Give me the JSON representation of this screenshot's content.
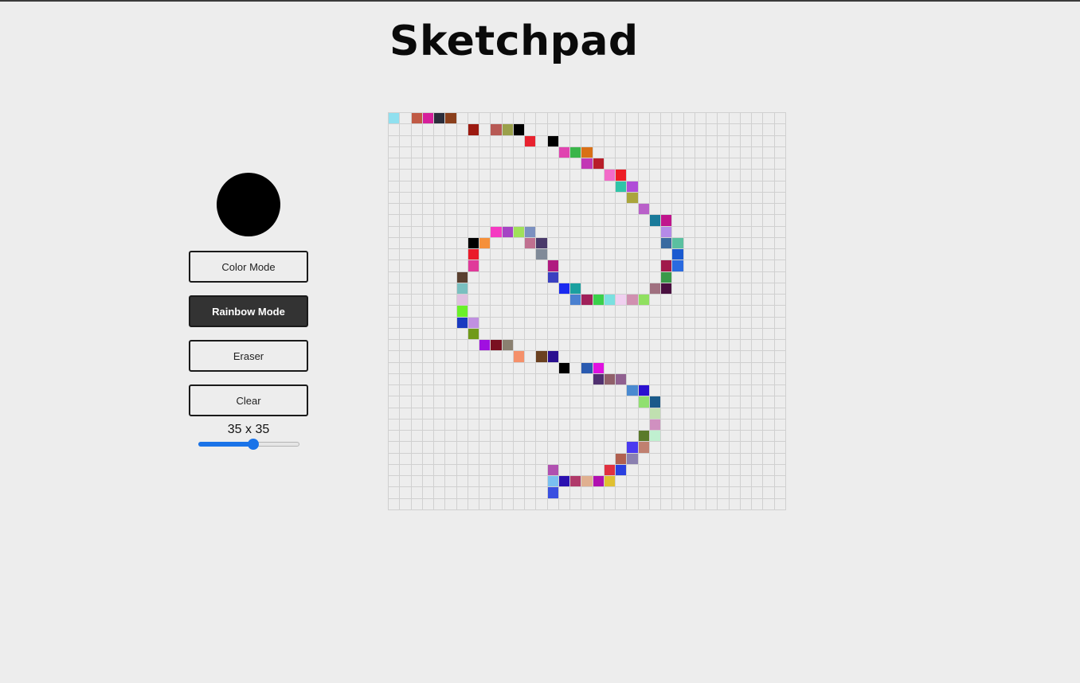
{
  "app": {
    "title": "Sketchpad"
  },
  "current_color": "#000000",
  "buttons": {
    "color_mode": "Color Mode",
    "rainbow_mode": "Rainbow Mode",
    "eraser": "Eraser",
    "clear": "Clear"
  },
  "active_mode": "rainbow_mode",
  "grid": {
    "size": 35,
    "size_label": "35 x 35",
    "slider": {
      "min": 1,
      "max": 64,
      "value": 35
    },
    "background": "#ededed",
    "line_color": "#d0d0d0",
    "painted": [
      [
        0,
        0,
        "#90e0ef"
      ],
      [
        0,
        2,
        "#c05a45"
      ],
      [
        0,
        3,
        "#d61f9b"
      ],
      [
        0,
        4,
        "#2b2d3b"
      ],
      [
        0,
        5,
        "#8a3f1c"
      ],
      [
        1,
        7,
        "#9c1a10"
      ],
      [
        1,
        9,
        "#b85a55"
      ],
      [
        1,
        10,
        "#9aa04a"
      ],
      [
        1,
        11,
        "#000000"
      ],
      [
        2,
        12,
        "#e8222f"
      ],
      [
        2,
        14,
        "#000000"
      ],
      [
        3,
        15,
        "#e044b0"
      ],
      [
        3,
        16,
        "#3ab54a"
      ],
      [
        3,
        17,
        "#d97016"
      ],
      [
        4,
        17,
        "#c238b5"
      ],
      [
        4,
        18,
        "#b81e2a"
      ],
      [
        5,
        19,
        "#f26ac8"
      ],
      [
        5,
        20,
        "#ed1c24"
      ],
      [
        6,
        20,
        "#2fc4a8"
      ],
      [
        6,
        21,
        "#b04dd8"
      ],
      [
        7,
        21,
        "#aaa53c"
      ],
      [
        8,
        22,
        "#b960c9"
      ],
      [
        9,
        23,
        "#1a7a9a"
      ],
      [
        9,
        24,
        "#c0158c"
      ],
      [
        10,
        9,
        "#f53ac2"
      ],
      [
        10,
        10,
        "#a544c4"
      ],
      [
        10,
        11,
        "#a0e05a"
      ],
      [
        10,
        12,
        "#7b90c0"
      ],
      [
        10,
        24,
        "#b58ae8"
      ],
      [
        11,
        7,
        "#000000"
      ],
      [
        11,
        8,
        "#f5903a"
      ],
      [
        11,
        12,
        "#c07090"
      ],
      [
        11,
        13,
        "#4a3a6a"
      ],
      [
        11,
        24,
        "#3a6aa0"
      ],
      [
        11,
        25,
        "#5ac0a0"
      ],
      [
        12,
        7,
        "#ea1a2a"
      ],
      [
        12,
        13,
        "#808a98"
      ],
      [
        12,
        25,
        "#1a5ad0"
      ],
      [
        13,
        7,
        "#e03a9a"
      ],
      [
        13,
        14,
        "#b01a80"
      ],
      [
        13,
        24,
        "#a01a4a"
      ],
      [
        13,
        25,
        "#2a6ae0"
      ],
      [
        14,
        6,
        "#5a4030"
      ],
      [
        14,
        14,
        "#3a40c0"
      ],
      [
        14,
        24,
        "#3a9a4a"
      ],
      [
        15,
        6,
        "#7ac0c0"
      ],
      [
        15,
        15,
        "#1a2af0"
      ],
      [
        15,
        16,
        "#1aa0a0"
      ],
      [
        15,
        23,
        "#a07080"
      ],
      [
        15,
        24,
        "#4a1040"
      ],
      [
        16,
        6,
        "#e0c0e0"
      ],
      [
        16,
        16,
        "#4a80d0"
      ],
      [
        16,
        17,
        "#a0205a"
      ],
      [
        16,
        18,
        "#3ad04a"
      ],
      [
        16,
        19,
        "#7ae0e0"
      ],
      [
        16,
        20,
        "#f0d0f0"
      ],
      [
        16,
        21,
        "#d090b0"
      ],
      [
        16,
        22,
        "#90e060"
      ],
      [
        17,
        6,
        "#6af02a"
      ],
      [
        18,
        6,
        "#1a3ac0"
      ],
      [
        18,
        7,
        "#c090e0"
      ],
      [
        19,
        7,
        "#709a1a"
      ],
      [
        20,
        8,
        "#a010e0"
      ],
      [
        20,
        9,
        "#7a1020"
      ],
      [
        20,
        10,
        "#8a8070"
      ],
      [
        21,
        11,
        "#f5906a"
      ],
      [
        21,
        13,
        "#6a4020"
      ],
      [
        21,
        14,
        "#2a1090"
      ],
      [
        22,
        15,
        "#000000"
      ],
      [
        22,
        17,
        "#2a5ab0"
      ],
      [
        22,
        18,
        "#e010e0"
      ],
      [
        23,
        18,
        "#503070"
      ],
      [
        23,
        19,
        "#90606a"
      ],
      [
        23,
        20,
        "#906090"
      ],
      [
        24,
        21,
        "#4a8ad0"
      ],
      [
        24,
        22,
        "#2a10d0"
      ],
      [
        25,
        22,
        "#90e070"
      ],
      [
        25,
        23,
        "#1a5a8a"
      ],
      [
        26,
        23,
        "#c0e0b0"
      ],
      [
        27,
        23,
        "#d090c0"
      ],
      [
        28,
        22,
        "#5a7a2a"
      ],
      [
        28,
        23,
        "#c0f0d0"
      ],
      [
        29,
        21,
        "#4a3af0"
      ],
      [
        29,
        22,
        "#c08070"
      ],
      [
        30,
        20,
        "#b06050"
      ],
      [
        30,
        21,
        "#8a80b0"
      ],
      [
        31,
        14,
        "#b050b0"
      ],
      [
        31,
        19,
        "#e03040"
      ],
      [
        31,
        20,
        "#2a40e0"
      ],
      [
        32,
        14,
        "#7ac0f0"
      ],
      [
        32,
        15,
        "#2a10b0"
      ],
      [
        32,
        16,
        "#b03a6a"
      ],
      [
        32,
        17,
        "#e0b090"
      ],
      [
        32,
        18,
        "#b010b0"
      ],
      [
        32,
        19,
        "#e0c030"
      ],
      [
        33,
        14,
        "#3a50e0"
      ]
    ]
  }
}
